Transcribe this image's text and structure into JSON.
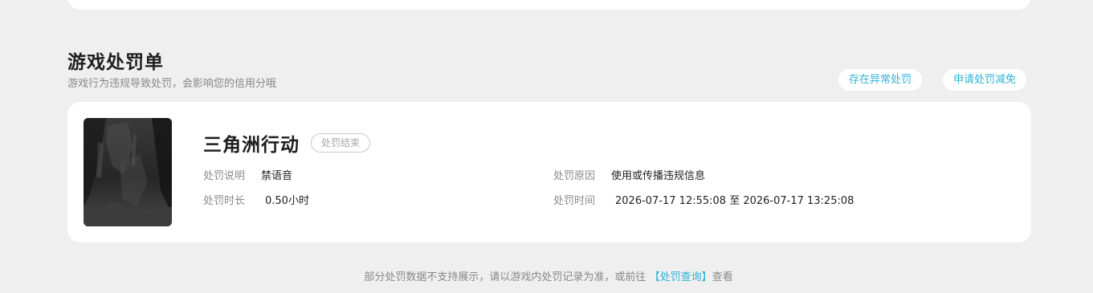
{
  "section": {
    "title": "游戏处罚单",
    "subtitle": "游戏行为违规导致处罚，会影响您的信用分哦"
  },
  "actions": {
    "abnormal_label": "存在异常处罚",
    "reduce_label": "申请处罚减免"
  },
  "penalty": {
    "game_name": "三角洲行动",
    "status": "处罚结束",
    "fields": {
      "description_label": "处罚说明",
      "description_value": "禁语音",
      "reason_label": "处罚原因",
      "reason_value": "使用或传播违规信息",
      "duration_label": "处罚时长",
      "duration_value": "0.50小时",
      "time_label": "处罚时间",
      "time_value": "2026-07-17 12:55:08 至 2026-07-17 13:25:08"
    }
  },
  "footer": {
    "text_before": "部分处罚数据不支持展示，请以游戏内处罚记录为准，或前往",
    "link_label": "【处罚查询】",
    "text_after": "查看"
  },
  "colors": {
    "page_background": "#efefef",
    "card_background": "#ffffff",
    "accent": "#2fb2d6"
  }
}
